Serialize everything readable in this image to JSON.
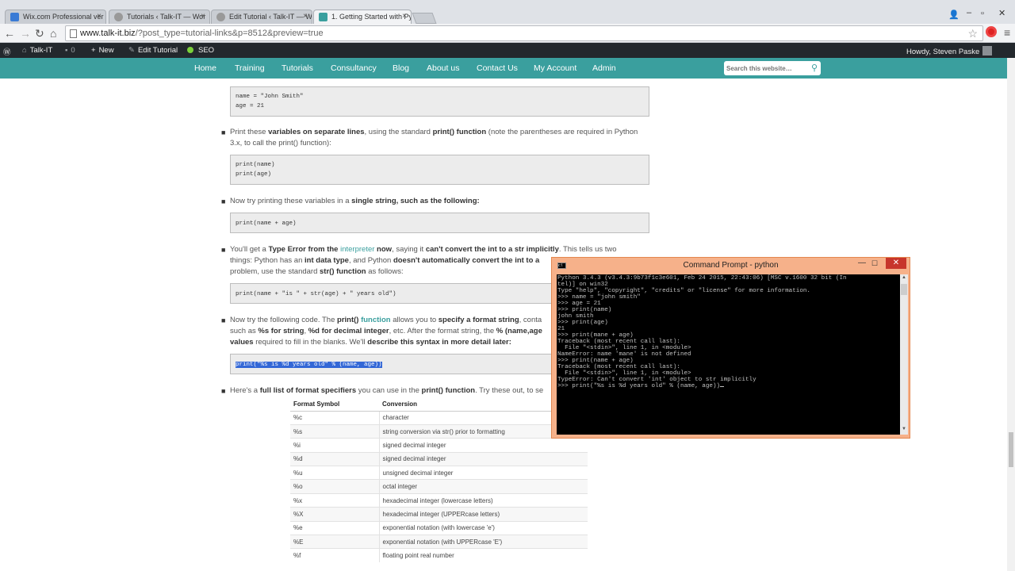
{
  "browser": {
    "tabs": [
      {
        "label": "Wix.com Professional ver",
        "favicon_color": "#3a7bd5"
      },
      {
        "label": "Tutorials ‹ Talk-IT — Wor",
        "favicon_color": "#999999"
      },
      {
        "label": "Edit Tutorial ‹ Talk-IT — W",
        "favicon_color": "#999999"
      },
      {
        "label": "1. Getting Started with Py",
        "favicon_color": "#3a9f9e"
      }
    ],
    "url_host": "www.talk-it.biz",
    "url_rest": "/?post_type=tutorial-links&p=8512&preview=true"
  },
  "adminbar": {
    "site": "Talk-IT",
    "comments": "0",
    "new": "New",
    "edit": "Edit Tutorial",
    "seo": "SEO",
    "howdy": "Howdy, Steven Paske"
  },
  "nav": {
    "items": [
      "Home",
      "Training",
      "Tutorials",
      "Consultancy",
      "Blog",
      "About us",
      "Contact Us",
      "My Account",
      "Admin"
    ],
    "search_placeholder": "Search this website…",
    "accent": "#3a9f9e"
  },
  "content": {
    "code1": [
      "name = \"John Smith\"",
      "age = 21"
    ],
    "b1_a": "Print these ",
    "b1_b": "variables on separate lines",
    "b1_c": ", using the standard ",
    "b1_d": "print() function",
    "b1_e": " (note the parentheses are required in Python 3.x, to call the print() function):",
    "code2": [
      "print(name)",
      "print(age)"
    ],
    "b2_a": "Now try printing these variables in a ",
    "b2_b": "single string, such as the following:",
    "code3": "print(name + age)",
    "b3_a": "You'll get a ",
    "b3_b": "Type Error from the ",
    "b3_c": "interpreter",
    "b3_d": " now",
    "b3_e": ", saying it ",
    "b3_f": "can't convert the int to a str implicitly",
    "b3_g": ". This tells us two things: Python has an ",
    "b3_h": "int data type",
    "b3_i": ", and Python ",
    "b3_j": "doesn't automatically convert the int to a",
    "b3_k": "problem, use the standard ",
    "b3_l": "str() function",
    "b3_m": " as follows:",
    "code4": "print(name + \"is \" + str(age) + \" years old\")",
    "b4_a": "Now try the following code. The ",
    "b4_b": "print()",
    "b4_c": " function",
    "b4_d": " allows you to ",
    "b4_e": "specify a format string",
    "b4_f": ", conta",
    "b4_g": "such as ",
    "b4_h": "%s for string",
    "b4_i": ", ",
    "b4_j": "%d for decimal integer",
    "b4_k": ", etc. After the format string, the ",
    "b4_l": "% (name,age",
    "b4_m": "values",
    "b4_n": " required to fill in the blanks. We'll ",
    "b4_o": "describe this syntax in more detail later:",
    "code5": "print(\"%s is %d years old\" % (name, age))",
    "b5_a": "Here's a ",
    "b5_b": "full list of format specifiers",
    "b5_c": " you can use in the ",
    "b5_d": "print() function",
    "b5_e": ". Try these out, to se",
    "table_headers": [
      "Format Symbol",
      "Conversion"
    ],
    "table_rows": [
      [
        "%c",
        "character"
      ],
      [
        "%s",
        "string conversion via str() prior to formatting"
      ],
      [
        "%i",
        "signed decimal integer"
      ],
      [
        "%d",
        "signed decimal integer"
      ],
      [
        "%u",
        "unsigned decimal integer"
      ],
      [
        "%o",
        "octal integer"
      ],
      [
        "%x",
        "hexadecimal integer (lowercase letters)"
      ],
      [
        "%X",
        "hexadecimal integer (UPPERcase letters)"
      ],
      [
        "%e",
        "exponential notation (with lowercase 'e')"
      ],
      [
        "%E",
        "exponential notation (with UPPERcase 'E')"
      ],
      [
        "%f",
        "floating point real number"
      ]
    ]
  },
  "cmd": {
    "title": "Command Prompt - python",
    "lines": [
      "Python 3.4.3 (v3.4.3:9b73f1c3e601, Feb 24 2015, 22:43:06) [MSC v.1600 32 bit (In",
      "tel)] on win32",
      "Type \"help\", \"copyright\", \"credits\" or \"license\" for more information.",
      ">>> name = \"john smith\"",
      ">>> age = 21",
      ">>> print(name)",
      "john smith",
      ">>> print(age)",
      "21",
      ">>> print(mane + age)",
      "Traceback (most recent call last):",
      "  File \"<stdin>\", line 1, in <module>",
      "NameError: name 'mane' is not defined",
      ">>> print(name + age)",
      "Traceback (most recent call last):",
      "  File \"<stdin>\", line 1, in <module>",
      "TypeError: Can't convert 'int' object to str implicitly",
      ">>> print(\"%s is %d years old\" % (name, age))"
    ]
  }
}
